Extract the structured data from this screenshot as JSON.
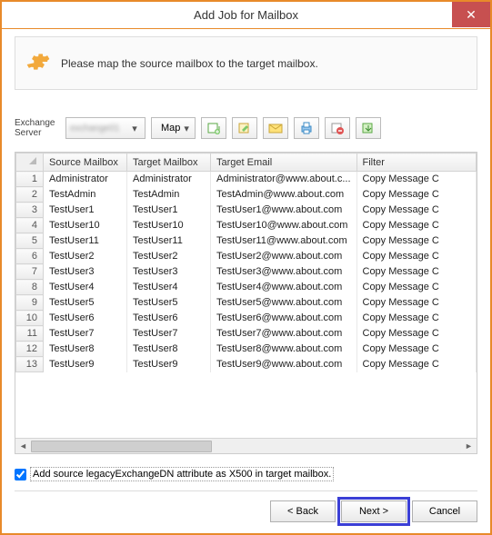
{
  "title": "Add Job for Mailbox",
  "info_message": "Please map the source mailbox to the target mailbox.",
  "exchange_label": "Exchange Server",
  "server_value": "exchange01",
  "map_button": "Map",
  "columns": {
    "rownum": "",
    "source": "Source Mailbox",
    "target": "Target Mailbox",
    "email": "Target Email",
    "filter": "Filter"
  },
  "rows": [
    {
      "n": "1",
      "src": "Administrator",
      "tgt": "Administrator",
      "email": "Administrator@www.about.c...",
      "filter": "Copy Message C"
    },
    {
      "n": "2",
      "src": "TestAdmin",
      "tgt": "TestAdmin",
      "email": "TestAdmin@www.about.com",
      "filter": "Copy Message C"
    },
    {
      "n": "3",
      "src": "TestUser1",
      "tgt": "TestUser1",
      "email": "TestUser1@www.about.com",
      "filter": "Copy Message C"
    },
    {
      "n": "4",
      "src": "TestUser10",
      "tgt": "TestUser10",
      "email": "TestUser10@www.about.com",
      "filter": "Copy Message C"
    },
    {
      "n": "5",
      "src": "TestUser11",
      "tgt": "TestUser11",
      "email": "TestUser11@www.about.com",
      "filter": "Copy Message C"
    },
    {
      "n": "6",
      "src": "TestUser2",
      "tgt": "TestUser2",
      "email": "TestUser2@www.about.com",
      "filter": "Copy Message C"
    },
    {
      "n": "7",
      "src": "TestUser3",
      "tgt": "TestUser3",
      "email": "TestUser3@www.about.com",
      "filter": "Copy Message C"
    },
    {
      "n": "8",
      "src": "TestUser4",
      "tgt": "TestUser4",
      "email": "TestUser4@www.about.com",
      "filter": "Copy Message C"
    },
    {
      "n": "9",
      "src": "TestUser5",
      "tgt": "TestUser5",
      "email": "TestUser5@www.about.com",
      "filter": "Copy Message C"
    },
    {
      "n": "10",
      "src": "TestUser6",
      "tgt": "TestUser6",
      "email": "TestUser6@www.about.com",
      "filter": "Copy Message C"
    },
    {
      "n": "11",
      "src": "TestUser7",
      "tgt": "TestUser7",
      "email": "TestUser7@www.about.com",
      "filter": "Copy Message C"
    },
    {
      "n": "12",
      "src": "TestUser8",
      "tgt": "TestUser8",
      "email": "TestUser8@www.about.com",
      "filter": "Copy Message C"
    },
    {
      "n": "13",
      "src": "TestUser9",
      "tgt": "TestUser9",
      "email": "TestUser9@www.about.com",
      "filter": "Copy Message C"
    }
  ],
  "checkbox_label": "Add source legacyExchangeDN attribute as X500 in target mailbox.",
  "checkbox_checked": true,
  "buttons": {
    "back": "< Back",
    "next": "Next >",
    "cancel": "Cancel"
  },
  "icons": {
    "map": "map-icon",
    "addrow": "add-row-icon",
    "editrow": "edit-row-icon",
    "envelope": "envelope-icon",
    "print": "print-icon",
    "delete": "delete-icon",
    "export": "export-icon"
  }
}
